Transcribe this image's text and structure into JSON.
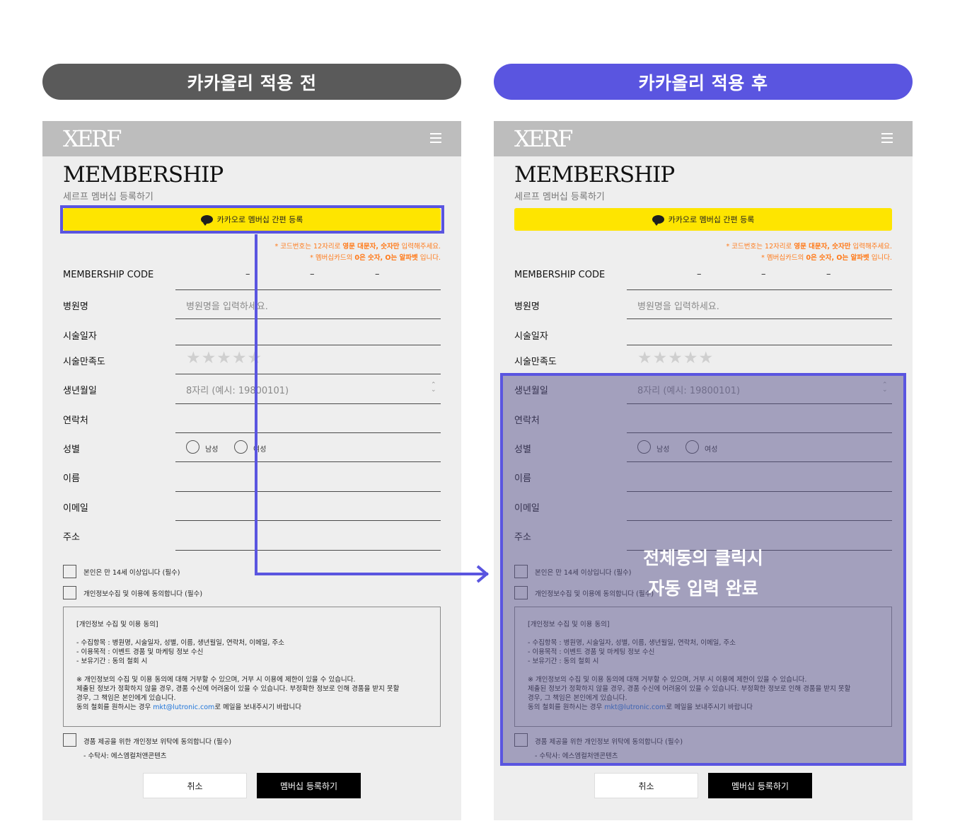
{
  "labels": {
    "before": "카카올리 적용 전",
    "after": "카카올리 적용 후"
  },
  "form": {
    "logo": "XERF",
    "title": "MEMBERSHIP",
    "subtitle": "세르프 멤버십 등록하기",
    "kakao_button": "카카오로 멤버십 간편 등록",
    "notes": {
      "line1_a": "* 코드번호는 12자리로 ",
      "line1_b": "영문 대문자, 숫자만",
      "line1_c": " 입력해주세요.",
      "line2_a": "* 멤버십카드의 ",
      "line2_b": "0은 숫자, O는 알파벳",
      "line2_c": " 입니다."
    },
    "fields": {
      "code_label": "MEMBERSHIP CODE",
      "code_sep": "–",
      "hospital_label": "병원명",
      "hospital_placeholder": "병원명을 입력하세요.",
      "date_label": "시술일자",
      "satisfaction_label": "시술만족도",
      "stars": "★★★★★",
      "birth_label": "생년월일",
      "birth_placeholder": "8자리 (예시: 19800101)",
      "phone_label": "연락처",
      "gender_label": "성별",
      "gender_male": "남성",
      "gender_female": "여성",
      "name_label": "이름",
      "email_label": "이메일",
      "address_label": "주소"
    },
    "agree_age": "본인은 만 14세 이상입니다 (필수)",
    "agree_privacy": "개인정보수집 및 이용에 동의합니다 (필수)",
    "consent": {
      "heading": "[개인정보 수집 및 이용 동의]",
      "item1": "- 수집항목 : 병원명, 시술일자, 성별, 이름, 생년월일, 연락처, 이메일, 주소",
      "item2": "- 이용목적 : 이벤트 경품 및 마케팅 정보 수신",
      "item3": "- 보유기간 : 동의 철회 시",
      "warn1": "※ 개인정보의 수집 및 이용 동의에 대해 거부할 수 있으며, 거부 시 이용에 제한이 있을 수 있습니다.",
      "warn2": "제출된 정보가 정확하지 않을 경우, 경품 수신에 어려움이 있을 수 있습니다. 부정확한 정보로 인해 경품을 받지 못할",
      "warn3": "경우, 그 책임은 본인에게 있습니다.",
      "withdraw_a": "동의 철회를 원하시는 경우 ",
      "withdraw_email": "mkt@lutronic.com",
      "withdraw_b": "로 메일을 보내주시기 바랍니다"
    },
    "agree_consign": "경품 제공을 위한 개인정보 위탁에 동의합니다 (필수)",
    "consign_note": "- 수탁사: 에스엠컬처앤콘텐츠",
    "cancel": "취소",
    "submit": "멤버십 등록하기"
  },
  "overlay": {
    "line1": "전체동의 클릭시",
    "line2": "자동 입력 완료"
  },
  "colors": {
    "accent": "#5a55e0",
    "kakao": "#fee500",
    "note": "#ff7a1a"
  }
}
